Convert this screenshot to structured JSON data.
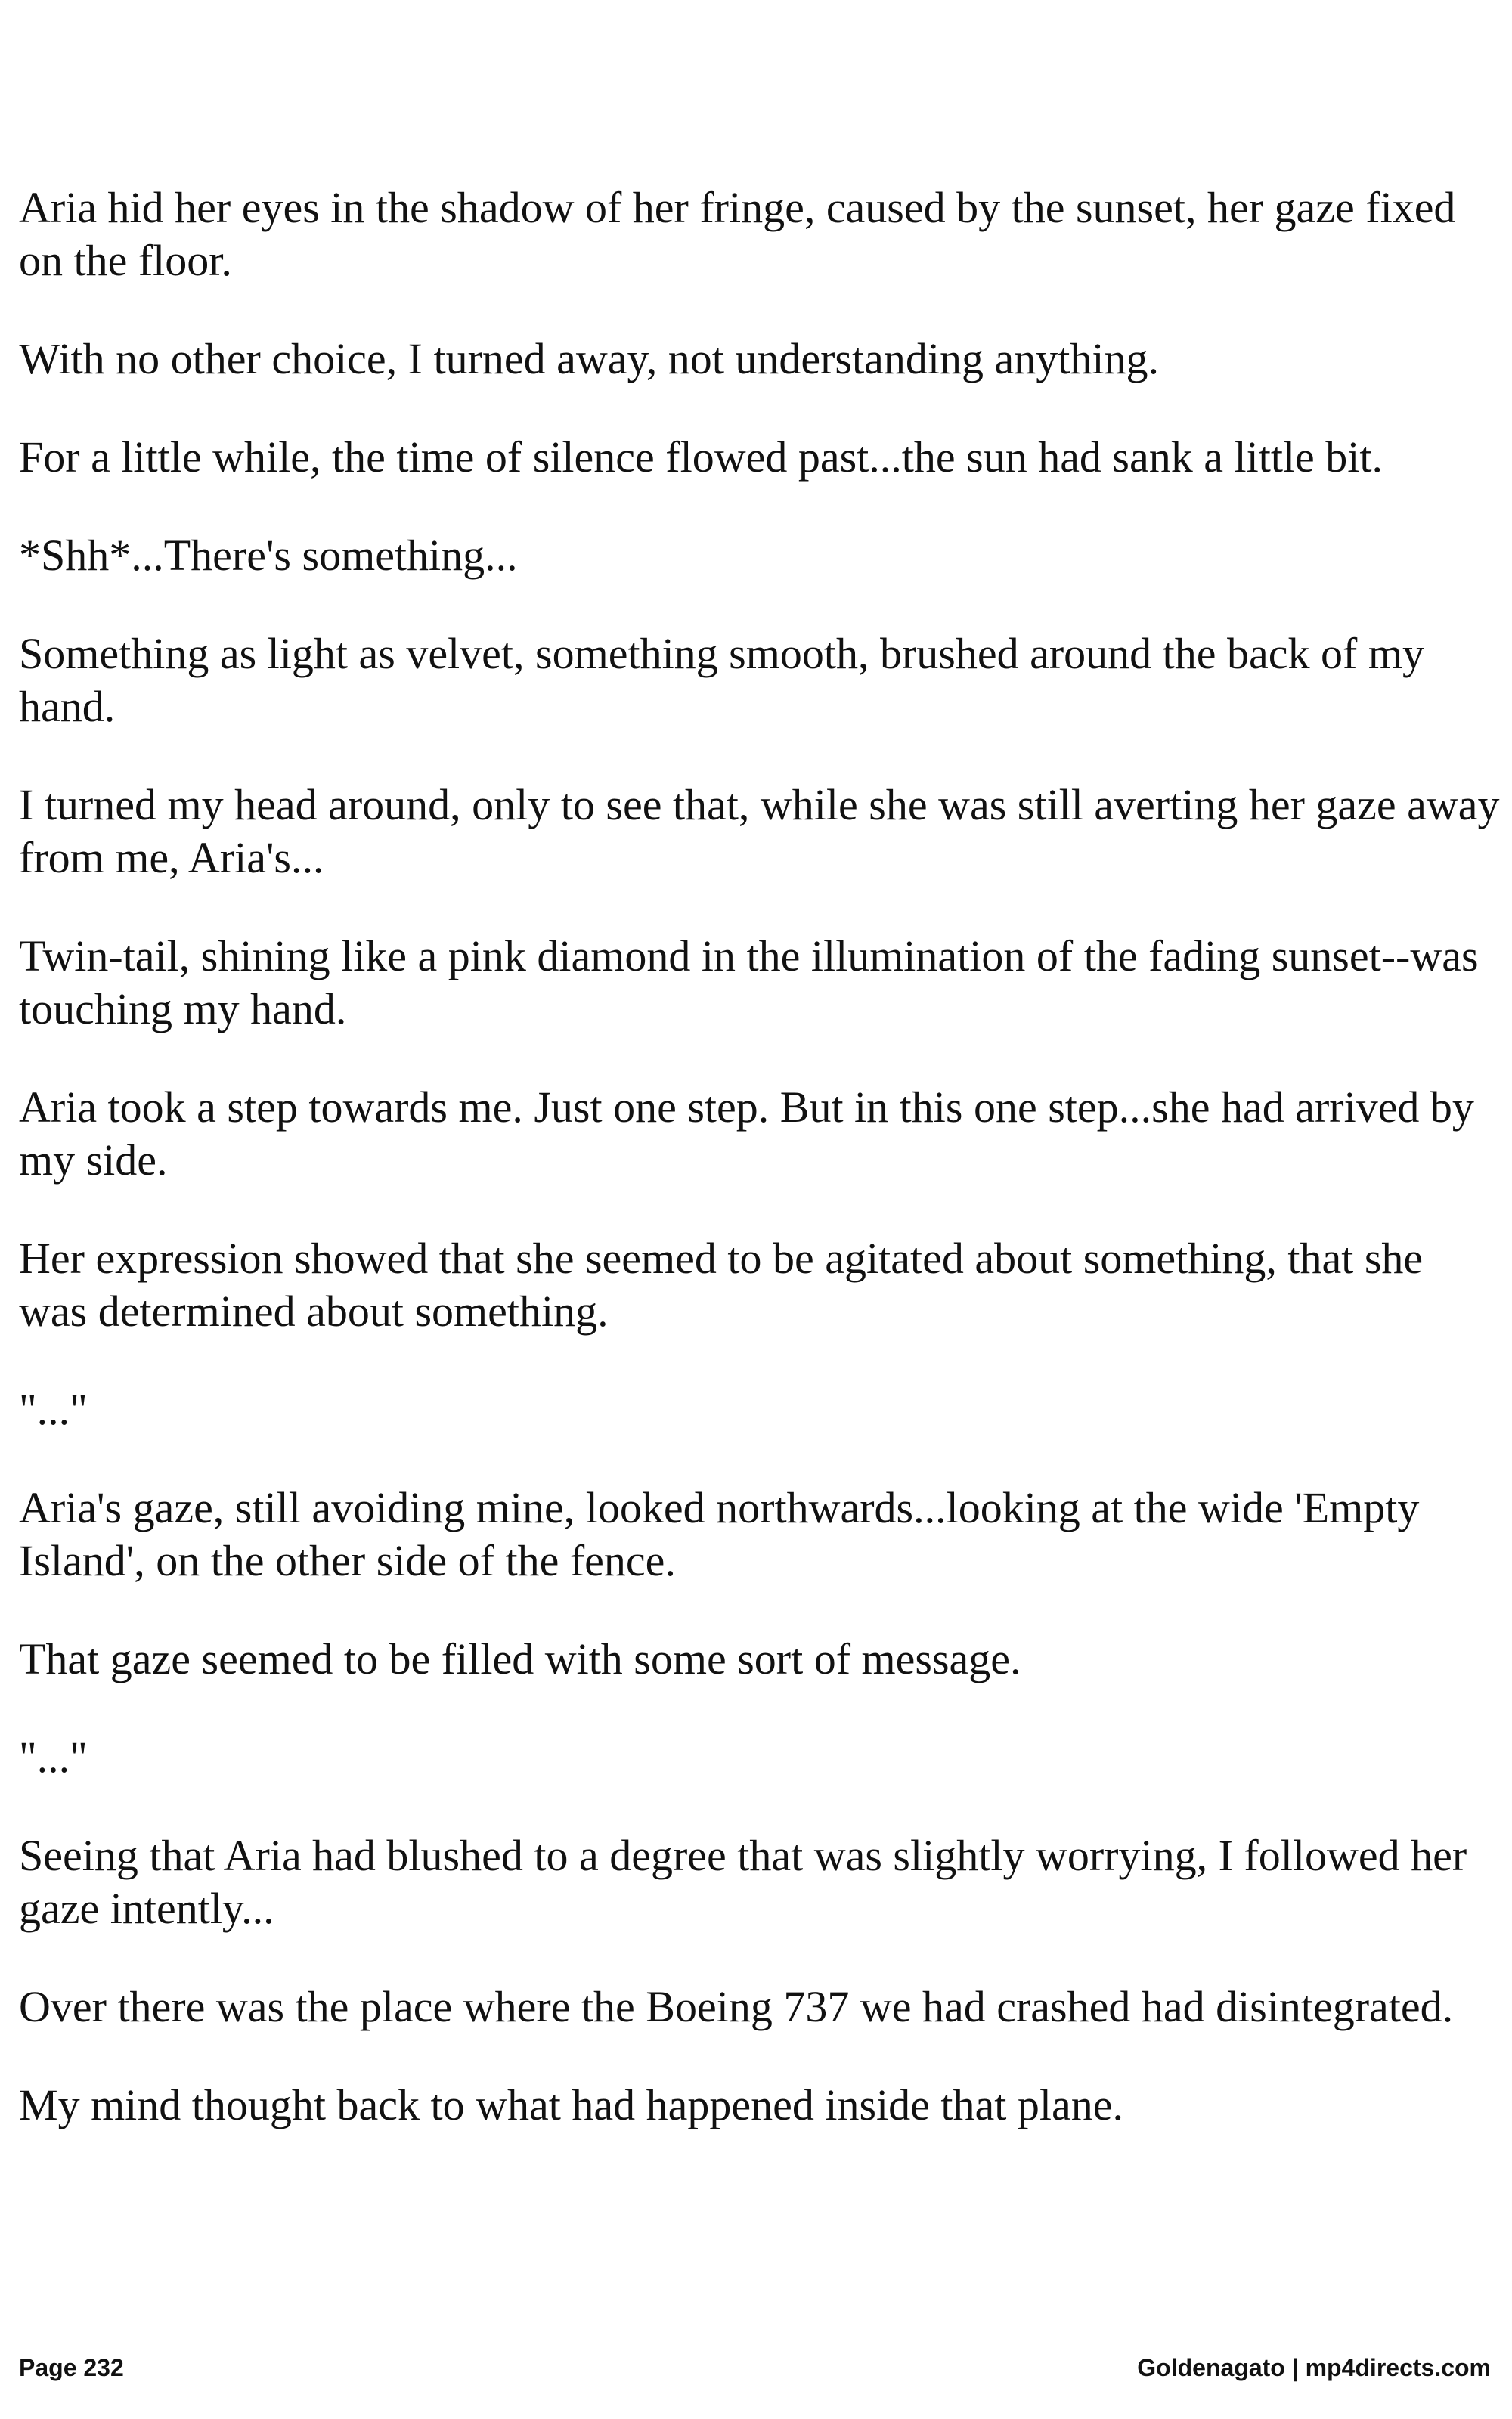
{
  "paragraphs": [
    "Aria hid her eyes in the shadow of her fringe, caused by the sunset, her gaze fixed on the floor.",
    "With no other choice, I turned away, not understanding anything.",
    "For a little while, the time of silence flowed past...the sun had sank a little bit.",
    "*Shh*...There's something...",
    "Something as light as velvet, something smooth, brushed around the back of my hand.",
    "I turned my head around, only to see that, while she was still averting her gaze away from me, Aria's...",
    "Twin-tail, shining like a pink diamond in the illumination of the fading sunset--was touching my hand.",
    "Aria took a step towards me. Just one step. But in this one step...she had arrived by my side.",
    "Her expression showed that she seemed to be agitated about something, that she was determined about something.",
    "\"...\"",
    "Aria's gaze, still avoiding mine, looked northwards...looking at the wide 'Empty Island', on the other side of the fence.",
    "That gaze seemed to be filled with some sort of message.",
    "\"...\"",
    "Seeing that Aria had blushed to a degree that was slightly worrying, I followed her gaze intently...",
    "Over there was the place where the Boeing 737 we had crashed had disintegrated.",
    "My mind thought back to what had happened inside that plane."
  ],
  "footer": {
    "page_label": "Page 232",
    "credit": "Goldenagato | mp4directs.com"
  }
}
